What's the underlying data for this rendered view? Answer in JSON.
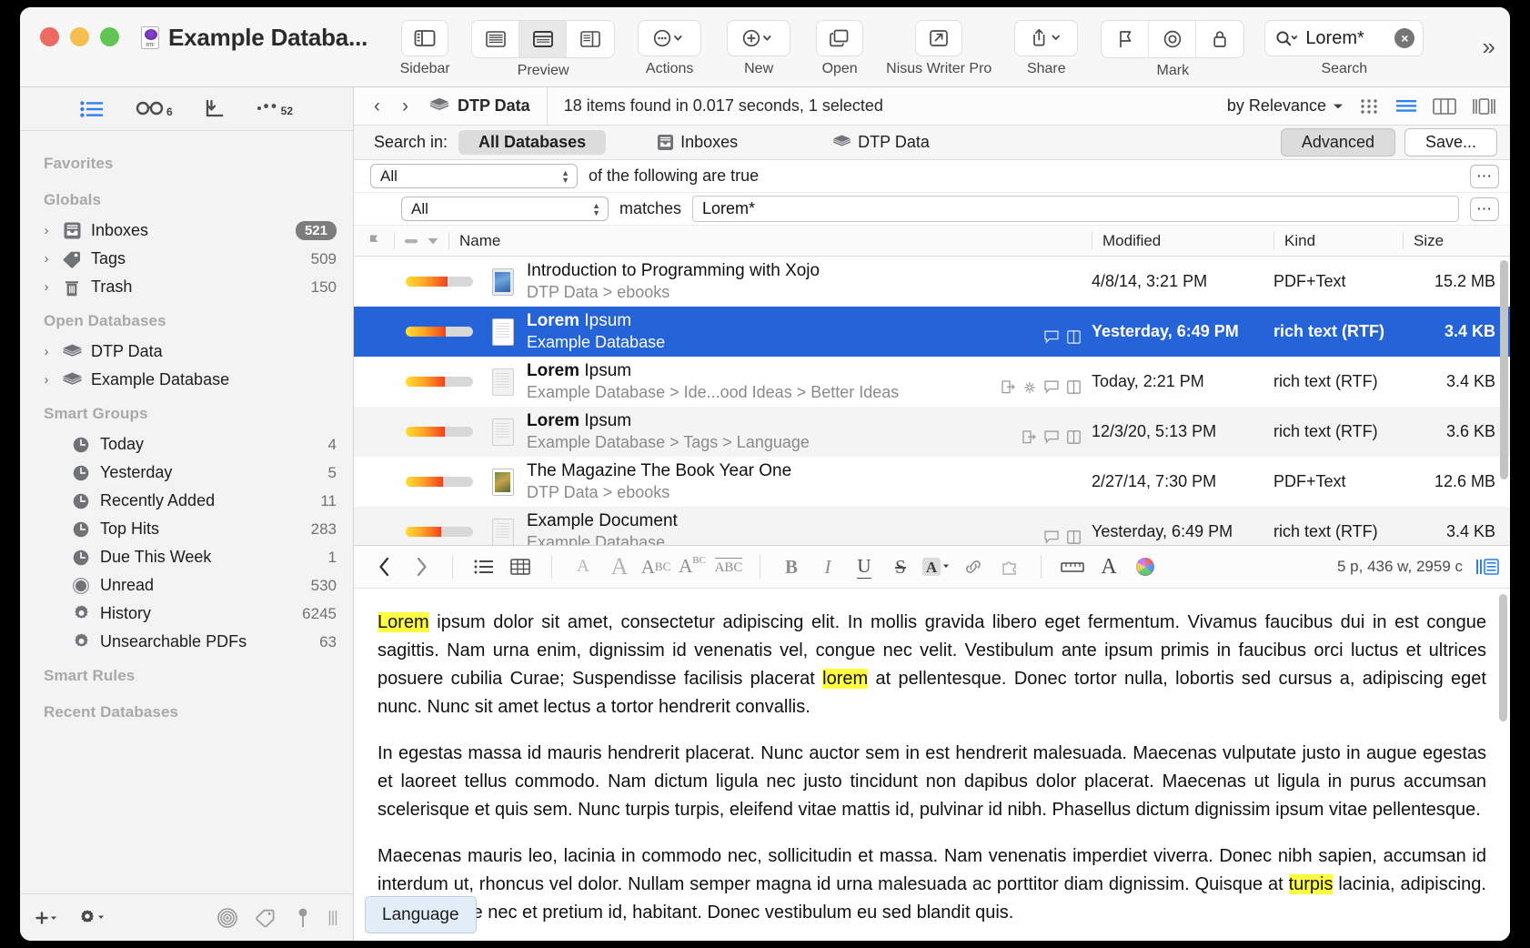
{
  "window": {
    "title": "Example Databa...",
    "title_icon": "rtf-document-icon"
  },
  "toolbar": {
    "groups": [
      {
        "label": "Sidebar",
        "icons": [
          "sidebar-toggle-icon"
        ]
      },
      {
        "label": "Preview",
        "icons": [
          "view-text-icon",
          "view-split-icon",
          "view-details-icon"
        ]
      },
      {
        "label": "Actions",
        "icons": [
          "actions-ellipsis-icon",
          "chevron-down-icon"
        ]
      },
      {
        "label": "New",
        "icons": [
          "plus-circle-icon",
          "chevron-down-icon"
        ]
      },
      {
        "label": "Open",
        "icons": [
          "open-windows-icon"
        ]
      },
      {
        "label": "Nisus Writer Pro",
        "icons": [
          "external-open-icon"
        ]
      },
      {
        "label": "Share",
        "icons": [
          "share-icon",
          "chevron-down-icon"
        ]
      },
      {
        "label": "Mark",
        "icons": [
          "flag-icon",
          "target-icon",
          "lock-icon"
        ]
      },
      {
        "label": "Search",
        "icons": [
          "search-icon"
        ]
      }
    ],
    "search_value": "Lorem*",
    "overflow_label": "more-toolbar-items",
    "colors": {
      "accent": "#2563d8",
      "highlight": "#ffff40"
    }
  },
  "sidebar": {
    "top_buttons": [
      {
        "name": "list-view-icon",
        "badge": ""
      },
      {
        "name": "glasses-reading-icon",
        "badge": "6"
      },
      {
        "name": "import-arrow-icon",
        "badge": ""
      },
      {
        "name": "more-dots-icon",
        "badge": "52"
      }
    ],
    "sections": [
      {
        "title": "Favorites",
        "items": []
      },
      {
        "title": "Globals",
        "items": [
          {
            "label": "Inboxes",
            "count": "521",
            "pill": true,
            "icon": "inbox-icon",
            "disclosure": true
          },
          {
            "label": "Tags",
            "count": "509",
            "pill": false,
            "icon": "tag-icon",
            "disclosure": true
          },
          {
            "label": "Trash",
            "count": "150",
            "pill": false,
            "icon": "trash-icon",
            "disclosure": true
          }
        ]
      },
      {
        "title": "Open Databases",
        "items": [
          {
            "label": "DTP Data",
            "count": "",
            "pill": false,
            "icon": "database-icon",
            "disclosure": true
          },
          {
            "label": "Example Database",
            "count": "",
            "pill": false,
            "icon": "database-icon",
            "disclosure": true
          }
        ]
      },
      {
        "title": "Smart Groups",
        "items": [
          {
            "label": "Today",
            "count": "4",
            "pill": false,
            "icon": "clock-icon",
            "disclosure": false
          },
          {
            "label": "Yesterday",
            "count": "5",
            "pill": false,
            "icon": "clock-icon",
            "disclosure": false
          },
          {
            "label": "Recently Added",
            "count": "11",
            "pill": false,
            "icon": "clock-icon",
            "disclosure": false
          },
          {
            "label": "Top Hits",
            "count": "283",
            "pill": false,
            "icon": "clock-icon",
            "disclosure": false
          },
          {
            "label": "Due This Week",
            "count": "1",
            "pill": false,
            "icon": "clock-icon",
            "disclosure": false
          },
          {
            "label": "Unread",
            "count": "530",
            "pill": false,
            "icon": "unread-circle-icon",
            "disclosure": false
          },
          {
            "label": "History",
            "count": "6245",
            "pill": false,
            "icon": "gear-icon",
            "disclosure": false
          },
          {
            "label": "Unsearchable PDFs",
            "count": "63",
            "pill": false,
            "icon": "gear-icon",
            "disclosure": false
          }
        ]
      },
      {
        "title": "Smart Rules",
        "items": []
      },
      {
        "title": "Recent Databases",
        "items": []
      }
    ],
    "bottom_icons": [
      "add-plus-icon",
      "settings-gear-icon",
      "target-rings-icon",
      "tag-outline-icon",
      "pin-icon",
      "resize-grip-icon"
    ]
  },
  "navbar": {
    "back_icon": "chevron-left-icon",
    "forward_icon": "chevron-right-icon",
    "database": "DTP Data",
    "status": "18 items found in 0.017 seconds, 1 selected",
    "sort_label": "by Relevance",
    "view_icons": [
      "icon-grid-view",
      "list-view",
      "column-view",
      "split-view"
    ]
  },
  "searchscope": {
    "label": "Search in:",
    "tabs": [
      {
        "label": "All Databases",
        "active": true,
        "icon": ""
      },
      {
        "label": "Inboxes",
        "active": false,
        "icon": "inbox-icon"
      },
      {
        "label": "DTP Data",
        "active": false,
        "icon": "database-icon"
      }
    ],
    "advanced_label": "Advanced",
    "save_label": "Save..."
  },
  "criteria": {
    "row1": {
      "select": "All",
      "text": "of the following are true",
      "menu_icon": "ellipsis-button"
    },
    "row2": {
      "select": "All",
      "operator": "matches",
      "value": "Lorem*",
      "menu_icon": "ellipsis-button"
    }
  },
  "table": {
    "headers": {
      "flag": "flag-column",
      "state": "state-column",
      "name": "Name",
      "modified": "Modified",
      "kind": "Kind",
      "size": "Size"
    },
    "rows": [
      {
        "name_bold": "",
        "name": "Introduction to Programming with Xojo",
        "path": "DTP Data > ebooks",
        "modified": "4/8/14, 3:21 PM",
        "kind": "PDF+Text",
        "size": "15.2 MB",
        "score": 62,
        "icon": "pdf-book-icon",
        "marks": [],
        "selected": false,
        "alt": false
      },
      {
        "name_bold": "Lorem",
        "name": " Ipsum",
        "path": "Example Database",
        "modified": "Yesterday, 6:49 PM",
        "kind": "rich text (RTF)",
        "size": "3.4 KB",
        "score": 60,
        "icon": "rtf-document-icon",
        "marks": [
          "comment-icon",
          "columns-icon"
        ],
        "selected": true,
        "alt": false
      },
      {
        "name_bold": "Lorem",
        "name": " Ipsum",
        "path": "Example Database > Ide...ood Ideas > Better Ideas",
        "modified": "Today, 2:21 PM",
        "kind": "rich text (RTF)",
        "size": "3.4 KB",
        "score": 58,
        "icon": "rtf-document-icon",
        "marks": [
          "export-icon",
          "flower-icon",
          "comment-icon",
          "columns-icon"
        ],
        "selected": false,
        "alt": false
      },
      {
        "name_bold": "Lorem",
        "name": " Ipsum",
        "path": "Example Database > Tags > Language",
        "modified": "12/3/20, 5:13 PM",
        "kind": "rich text (RTF)",
        "size": "3.6 KB",
        "score": 58,
        "icon": "rtf-document-icon",
        "marks": [
          "export-icon",
          "comment-icon",
          "columns-icon"
        ],
        "selected": false,
        "alt": true
      },
      {
        "name_bold": "",
        "name": "The Magazine The Book Year One",
        "path": "DTP Data > ebooks",
        "modified": "2/27/14, 7:30 PM",
        "kind": "PDF+Text",
        "size": "12.6 MB",
        "score": 55,
        "icon": "magazine-icon",
        "marks": [],
        "selected": false,
        "alt": false
      },
      {
        "name_bold": "",
        "name": "Example Document",
        "path": "Example Database",
        "modified": "Yesterday, 6:49 PM",
        "kind": "rich text (RTF)",
        "size": "3.4 KB",
        "score": 53,
        "icon": "rtf-document-icon",
        "marks": [
          "comment-icon",
          "columns-icon"
        ],
        "selected": false,
        "alt": true
      }
    ]
  },
  "editor_toolbar": {
    "nav": [
      "chevron-left-icon",
      "chevron-right-icon"
    ],
    "list_tools": [
      "bullet-list-icon",
      "table-icon"
    ],
    "font_tools": [
      "font-small-icon",
      "font-large-icon",
      "font-lowercase-icon",
      "font-superscript-icon",
      "font-abc-overline-icon"
    ],
    "style_tools": [
      "bold-icon",
      "italic-icon",
      "underline-icon",
      "strikethrough-icon",
      "text-color-icon",
      "link-icon",
      "puzzle-icon"
    ],
    "extra_tools": [
      "ruler-icon",
      "fonts-panel-icon",
      "colors-wheel-icon"
    ],
    "stats": "5 p, 436 w, 2959 c",
    "inspector_icon": "inspector-icon"
  },
  "document": {
    "paragraphs": [
      {
        "segments": [
          {
            "t": "Lorem",
            "hl": true
          },
          {
            "t": " ipsum dolor sit amet, consectetur adipiscing elit. In mollis gravida libero eget fermentum. Vivamus faucibus dui in est congue sagittis. Nam urna enim, dignissim id venenatis vel, congue nec velit. Vestibulum ante ipsum primis in faucibus orci luctus et ultrices posuere cubilia Curae; Suspendisse facilisis placerat ",
            "hl": false
          },
          {
            "t": "lorem",
            "hl": true
          },
          {
            "t": " at pellentesque. Donec tortor nulla, lobortis sed cursus a, adipiscing eget nunc. Nunc sit amet lectus a tortor hendrerit convallis.",
            "hl": false
          }
        ]
      },
      {
        "segments": [
          {
            "t": "In egestas massa id mauris hendrerit placerat. Nunc auctor sem in est hendrerit malesuada. Maecenas vulputate justo in augue egestas et laoreet tellus commodo. Nam dictum ligula nec justo tincidunt non dapibus dolor placerat. Maecenas ut ligula in purus accumsan scelerisque et quis sem. Nunc turpis turpis, eleifend vitae mattis id, pulvinar id nibh. Phasellus dictum dignissim ipsum vitae pellentesque.",
            "hl": false
          }
        ]
      },
      {
        "segments": [
          {
            "t": "Maecenas mauris leo, lacinia in commodo nec, sollicitudin et massa. Nam venenatis imperdiet viverra. Donec nibh sapien, accumsan id interdum ut, rhoncus vel dolor. Nullam semper magna id urna malesuada ac porttitor diam dignissim. Quisque at ",
            "hl": false
          },
          {
            "t": "turpis",
            "hl": true
          },
          {
            "t": " lacinia, adipiscing. Pellentesque nec et pretium id, habitant. Donec vestibulum eu sed blandit quis.",
            "hl": false
          }
        ]
      }
    ],
    "language_chip": "Language"
  }
}
